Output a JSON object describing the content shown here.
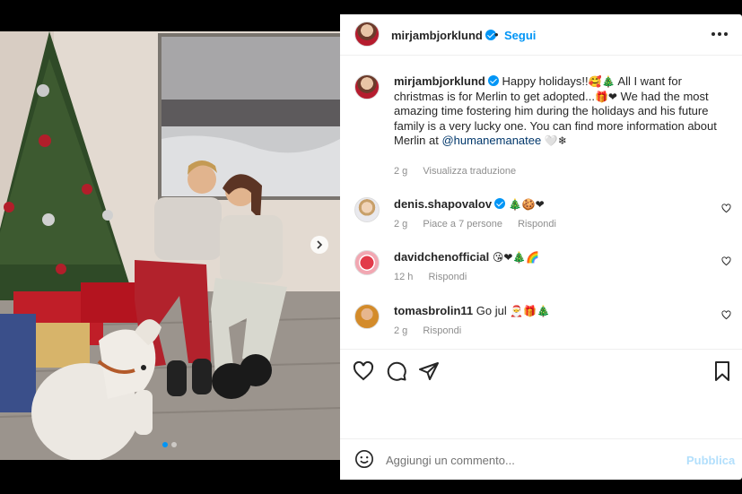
{
  "post": {
    "username": "mirjambjorklund",
    "follow_label": "Segui",
    "separator": "•",
    "caption_parts": {
      "p1": "Happy holidays!!",
      "e1": "🥰🎄",
      "p2": " All I want for christmas is for Merlin to get adopted...",
      "e2": "🎁❤",
      "p3": " We had the most amazing time fostering him during the holidays and his future family is a very lucky one. You can find more information about Merlin at ",
      "mention": "@humanemanatee",
      "e3": "🤍❄"
    },
    "caption_time": "2 g",
    "translate_label": "Visualizza traduzione"
  },
  "comments": [
    {
      "username": "denis.shapovalov",
      "verified": true,
      "text": "",
      "emojis": "🎄🍪❤",
      "time": "2 g",
      "likes": "Piace a 7 persone",
      "reply": "Rispondi",
      "avatar_icon": "avatar-denis"
    },
    {
      "username": "davidchenofficial",
      "verified": false,
      "text": "",
      "emojis": "😘❤🎄🌈",
      "time": "12 h",
      "likes": "",
      "reply": "Rispondi",
      "avatar_icon": "avatar-heart-flag"
    },
    {
      "username": "tomasbrolin11",
      "verified": false,
      "text": "Go jul ",
      "emojis": "🎅🎁🎄",
      "time": "2 g",
      "likes": "",
      "reply": "Rispondi",
      "avatar_icon": "avatar-tomas"
    }
  ],
  "add_comment": {
    "placeholder": "Aggiungi un commento...",
    "publish_label": "Pubblica"
  },
  "icons": {
    "like": "heart-icon",
    "comment": "comment-icon",
    "share": "share-icon",
    "save": "bookmark-icon",
    "more": "more-options-icon",
    "emoji": "emoji-icon",
    "next": "chevron-right-icon"
  },
  "colors": {
    "accent": "#0095f6",
    "publish_disabled": "#b2dffc",
    "mention": "#00376b",
    "meta": "#8e8e8e"
  },
  "carousel": {
    "total": 2,
    "current": 1
  }
}
